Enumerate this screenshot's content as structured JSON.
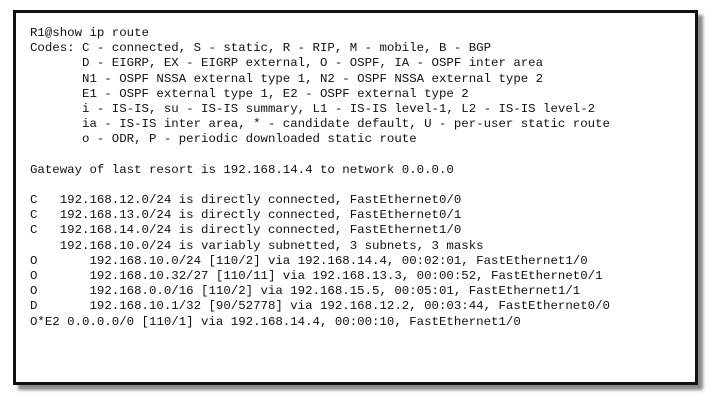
{
  "terminal": {
    "command": "R1@show ip route",
    "codes": [
      "Codes: C - connected, S - static, R - RIP, M - mobile, B - BGP",
      "       D - EIGRP, EX - EIGRP external, O - OSPF, IA - OSPF inter area",
      "       N1 - OSPF NSSA external type 1, N2 - OSPF NSSA external type 2",
      "       E1 - OSPF external type 1, E2 - OSPF external type 2",
      "       i - IS-IS, su - IS-IS summary, L1 - IS-IS level-1, L2 - IS-IS level-2",
      "       ia - IS-IS inter area, * - candidate default, U - per-user static route",
      "       o - ODR, P - periodic downloaded static route"
    ],
    "gateway": "Gateway of last resort is 192.168.14.4 to network 0.0.0.0",
    "routes": [
      "C   192.168.12.0/24 is directly connected, FastEthernet0/0",
      "C   192.168.13.0/24 is directly connected, FastEthernet0/1",
      "C   192.168.14.0/24 is directly connected, FastEthernet1/0",
      "    192.168.10.0/24 is variably subnetted, 3 subnets, 3 masks",
      "O       192.168.10.0/24 [110/2] via 192.168.14.4, 00:02:01, FastEthernet1/0",
      "O       192.168.10.32/27 [110/11] via 192.168.13.3, 00:00:52, FastEthernet0/1",
      "O       192.168.0.0/16 [110/2] via 192.168.15.5, 00:05:01, FastEthernet1/1",
      "D       192.168.10.1/32 [90/52778] via 192.168.12.2, 00:03:44, FastEthernet0/0",
      "O*E2 0.0.0.0/0 [110/1] via 192.168.14.4, 00:00:10, FastEthernet1/0"
    ]
  }
}
